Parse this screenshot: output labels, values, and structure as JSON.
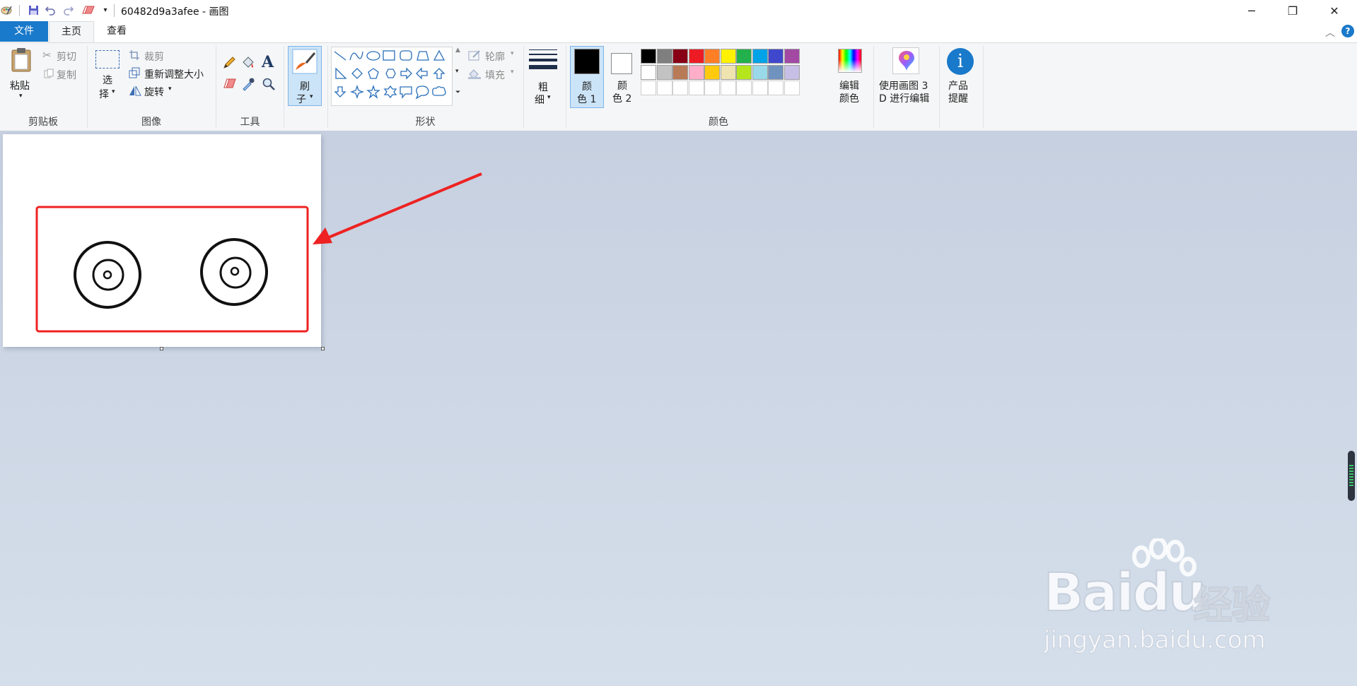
{
  "window": {
    "title": "60482d9a3afee - 画图",
    "controls": {
      "minimize": "─",
      "restore": "❐",
      "close": "✕"
    }
  },
  "tabs": {
    "file": "文件",
    "home": "主页",
    "view": "查看"
  },
  "ribbon": {
    "clipboard": {
      "paste": "粘贴",
      "cut": "剪切",
      "copy": "复制",
      "group": "剪贴板"
    },
    "image": {
      "select_line1": "选",
      "select_line2": "择",
      "crop": "裁剪",
      "resize": "重新调整大小",
      "rotate": "旋转",
      "group": "图像"
    },
    "tools": {
      "group": "工具"
    },
    "brushes": {
      "line1": "刷",
      "line2": "子"
    },
    "shapes": {
      "outline": "轮廓",
      "fill": "填充",
      "group": "形状"
    },
    "size": {
      "line1": "粗",
      "line2": "细"
    },
    "color1": {
      "line1": "颜",
      "line2": "色 1"
    },
    "color2": {
      "line1": "颜",
      "line2": "色 2"
    },
    "edit_colors": {
      "line1": "编辑",
      "line2": "颜色"
    },
    "paint3d": {
      "line1": "使用画图 3",
      "line2": "D 进行编辑"
    },
    "product_alert": {
      "line1": "产品",
      "line2": "提醒"
    },
    "colors_group": "颜色"
  },
  "palette": {
    "row1": [
      "#000000",
      "#7f7f7f",
      "#880015",
      "#ed1c24",
      "#ff7f27",
      "#fff200",
      "#22b14c",
      "#00a2e8",
      "#3f48cc",
      "#a349a4"
    ],
    "row2": [
      "#ffffff",
      "#c3c3c3",
      "#b97a57",
      "#ffaec9",
      "#ffc90e",
      "#efe4b0",
      "#b5e61d",
      "#99d9ea",
      "#7092be",
      "#c8bfe7"
    ],
    "row3_empty_count": 10,
    "color1": "#000000",
    "color2": "#ffffff"
  },
  "accent": {
    "file_tab": "#1979ca",
    "annotation": "#ee2222",
    "help": "#1979ca"
  },
  "watermark": {
    "brand": "Baidu",
    "cn": "经验",
    "url": "jingyan.baidu.com"
  }
}
